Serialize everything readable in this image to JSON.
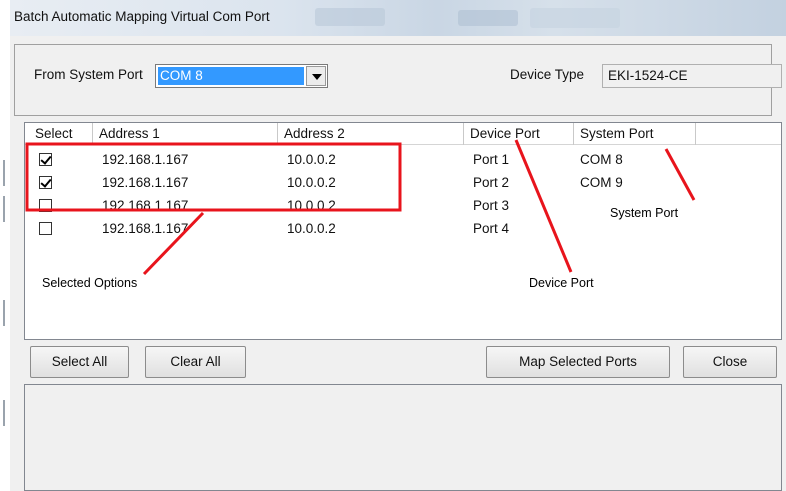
{
  "window": {
    "title": "Batch Automatic Mapping Virtual Com Port"
  },
  "form": {
    "from_system_port_label": "From System Port",
    "from_system_port_value": "COM 8",
    "device_type_label": "Device Type",
    "device_type_value": "EKI-1524-CE"
  },
  "table": {
    "columns": [
      "Select",
      "Address 1",
      "Address 2",
      "Device Port",
      "System Port"
    ],
    "rows": [
      {
        "checked": true,
        "address1": "192.168.1.167",
        "address2": "10.0.0.2",
        "device_port": "Port 1",
        "system_port": "COM 8"
      },
      {
        "checked": true,
        "address1": "192.168.1.167",
        "address2": "10.0.0.2",
        "device_port": "Port 2",
        "system_port": "COM 9"
      },
      {
        "checked": false,
        "address1": "192.168.1.167",
        "address2": "10.0.0.2",
        "device_port": "Port 3",
        "system_port": ""
      },
      {
        "checked": false,
        "address1": "192.168.1.167",
        "address2": "10.0.0.2",
        "device_port": "Port 4",
        "system_port": ""
      }
    ]
  },
  "buttons": {
    "select_all": "Select All",
    "clear_all": "Clear All",
    "map_selected": "Map Selected Ports",
    "close": "Close"
  },
  "annotations": {
    "selected_options": "Selected Options",
    "device_port": "Device Port",
    "system_port": "System Port",
    "color": "#e8141c"
  }
}
